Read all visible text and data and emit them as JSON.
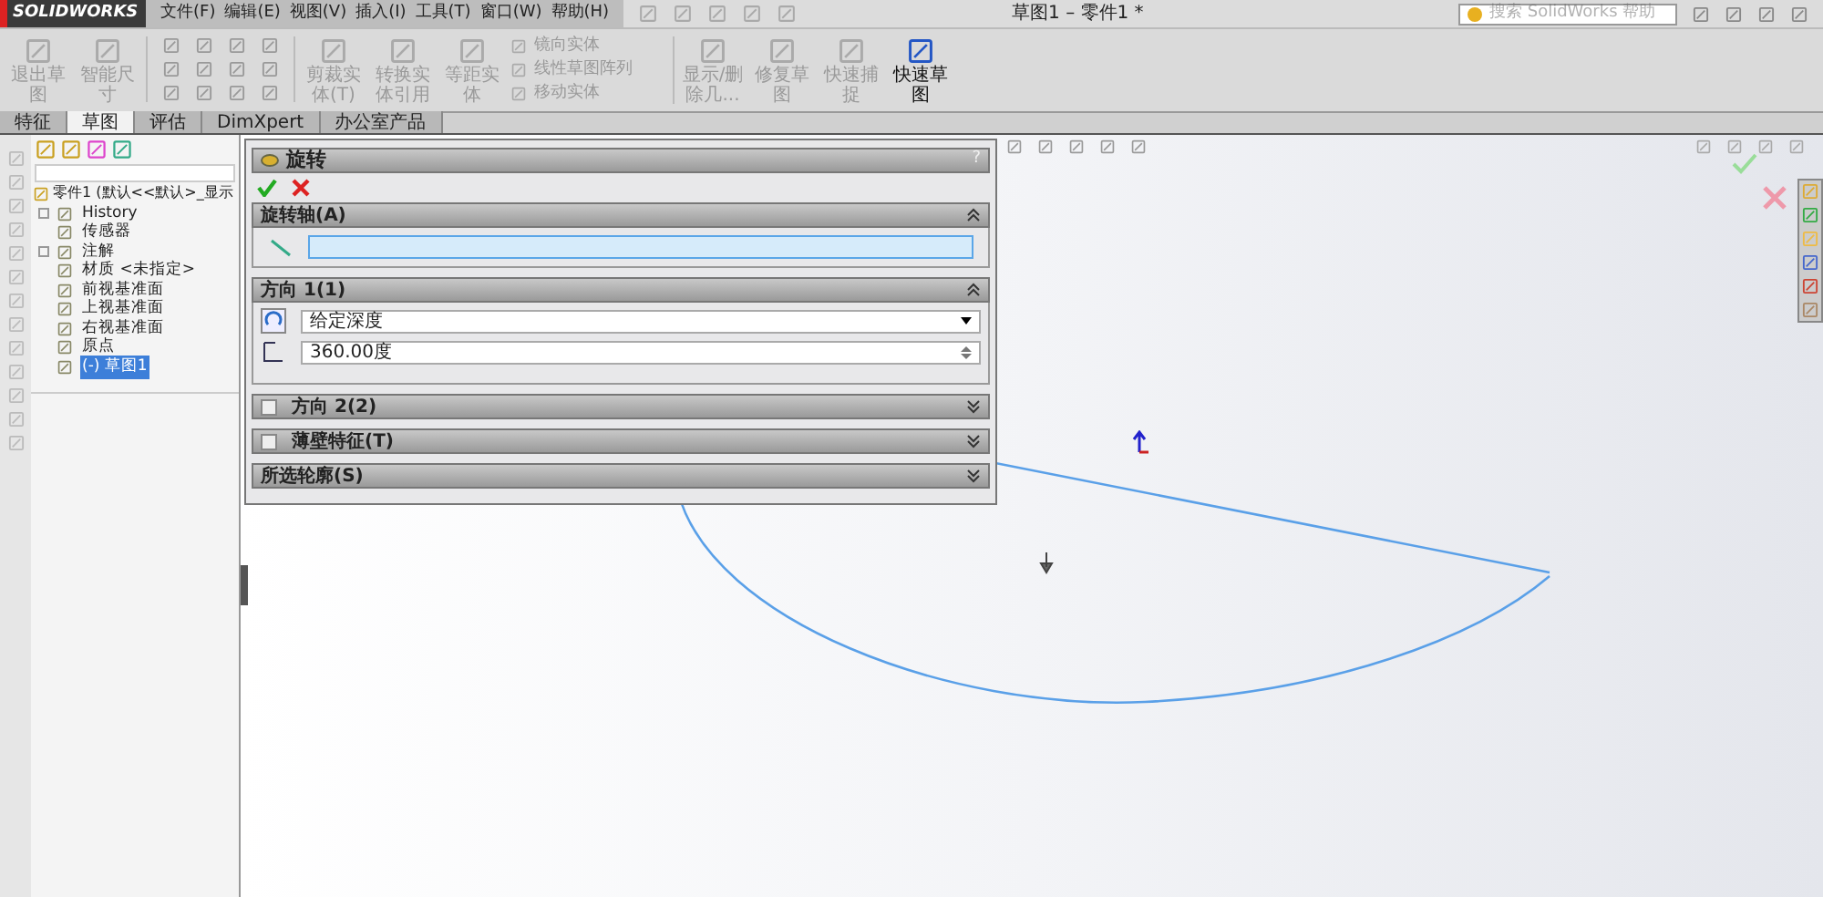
{
  "app": {
    "logo": "SOLIDWORKS",
    "menus": [
      "文件(F)",
      "编辑(E)",
      "视图(V)",
      "插入(I)",
      "工具(T)",
      "窗口(W)",
      "帮助(H)"
    ],
    "title": "草图1 – 零件1 *",
    "search": {
      "placeholder": "搜索 SolidWorks 帮助"
    }
  },
  "toolbar": [
    {
      "label": "退出草图",
      "disabled": true
    },
    {
      "label": "智能尺寸",
      "disabled": true
    },
    {
      "label": "剪裁实体(T)",
      "disabled": true
    },
    {
      "label": "转换实体引用",
      "disabled": true
    },
    {
      "label": "等距实体",
      "disabled": true
    }
  ],
  "toolbar_small": [
    {
      "label": "镜向实体",
      "disabled": true
    },
    {
      "label": "线性草图阵列",
      "disabled": true
    },
    {
      "label": "移动实体",
      "disabled": true
    }
  ],
  "toolbar_right": [
    {
      "label": "显示/删除几...",
      "disabled": true
    },
    {
      "label": "修复草图",
      "disabled": true
    },
    {
      "label": "快速捕捉",
      "disabled": true
    },
    {
      "label": "快速草图",
      "disabled": false
    }
  ],
  "tabs": [
    {
      "label": "特征",
      "selected": false
    },
    {
      "label": "草图",
      "selected": true
    },
    {
      "label": "评估",
      "selected": false
    },
    {
      "label": "DimXpert",
      "selected": false
    },
    {
      "label": "办公室产品",
      "selected": false
    }
  ],
  "tree": {
    "root": "零件1 (默认<<默认>_显示",
    "children": [
      {
        "label": "History",
        "expandable": true,
        "selected": false
      },
      {
        "label": "传感器",
        "expandable": false,
        "selected": false
      },
      {
        "label": "注解",
        "expandable": true,
        "selected": false
      },
      {
        "label": "材质 <未指定>",
        "expandable": false,
        "selected": false
      },
      {
        "label": "前视基准面",
        "expandable": false,
        "selected": false
      },
      {
        "label": "上视基准面",
        "expandable": false,
        "selected": false
      },
      {
        "label": "右视基准面",
        "expandable": false,
        "selected": false
      },
      {
        "label": "原点",
        "expandable": false,
        "selected": false
      },
      {
        "label": "(-) 草图1",
        "expandable": false,
        "selected": true
      }
    ]
  },
  "property_manager": {
    "title": "旋转",
    "help": "?",
    "sections": [
      {
        "title": "旋转轴(A)",
        "expanded": true,
        "kind": "axis"
      },
      {
        "title": "方向 1(1)",
        "expanded": true,
        "kind": "direction",
        "type_value": "给定深度",
        "angle_value": "360.00度"
      },
      {
        "title": "方向 2(2)",
        "expanded": false,
        "kind": "optional",
        "checked": false
      },
      {
        "title": "薄壁特征(T)",
        "expanded": false,
        "kind": "optional",
        "checked": false
      },
      {
        "title": "所选轮廓(S)",
        "expanded": false,
        "kind": "plain"
      }
    ]
  }
}
